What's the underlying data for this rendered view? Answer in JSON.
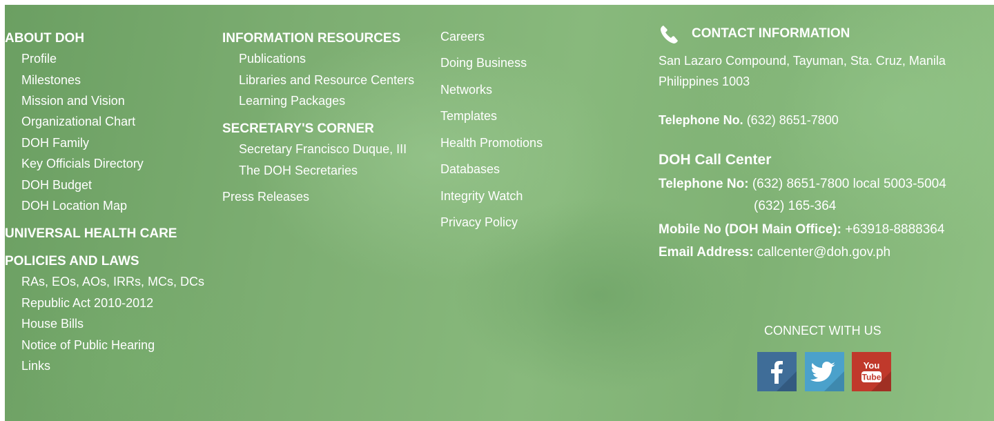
{
  "about": {
    "heading": "ABOUT DOH",
    "items": [
      "Profile",
      "Milestones",
      "Mission and Vision",
      "Organizational Chart",
      "DOH Family",
      "Key Officials Directory",
      "DOH Budget",
      "DOH Location Map"
    ]
  },
  "uhc": {
    "heading": "UNIVERSAL HEALTH CARE"
  },
  "policies": {
    "heading": "POLICIES AND LAWS",
    "items": [
      "RAs, EOs, AOs, IRRs, MCs, DCs",
      "Republic Act 2010-2012",
      "House Bills",
      "Notice of Public Hearing",
      "Links"
    ]
  },
  "info": {
    "heading": "INFORMATION RESOURCES",
    "items": [
      "Publications",
      "Libraries and Resource Centers",
      "Learning Packages"
    ]
  },
  "secretary": {
    "heading": "SECRETARY'S CORNER",
    "items": [
      "Secretary Francisco Duque, III",
      "The DOH Secretaries"
    ]
  },
  "press": {
    "label": "Press Releases"
  },
  "more_links": [
    "Careers",
    "Doing Business",
    "Networks",
    "Templates",
    "Health Promotions",
    "Databases",
    "Integrity Watch",
    "Privacy Policy"
  ],
  "contact": {
    "heading": "CONTACT INFORMATION",
    "address_line1": "San Lazaro Compound, Tayuman, Sta. Cruz, Manila",
    "address_line2": "Philippines 1003",
    "telephone_label": "Telephone No.",
    "telephone_value": "(632) 8651-7800",
    "call_center_heading": "DOH Call Center",
    "cc_tel_label": "Telephone No:",
    "cc_tel_value1": "(632) 8651-7800 local 5003-5004",
    "cc_tel_value2": "(632) 165-364",
    "mobile_label": "Mobile No (DOH Main Office):",
    "mobile_value": "+63918-8888364",
    "email_label": "Email Address:",
    "email_value": "callcenter@doh.gov.ph"
  },
  "connect": {
    "label": "CONNECT WITH US",
    "icons": [
      "facebook-icon",
      "twitter-icon",
      "youtube-icon"
    ],
    "colors": {
      "facebook": "#3f6d98",
      "twitter": "#4ba1cb",
      "youtube": "#c0392b"
    }
  }
}
